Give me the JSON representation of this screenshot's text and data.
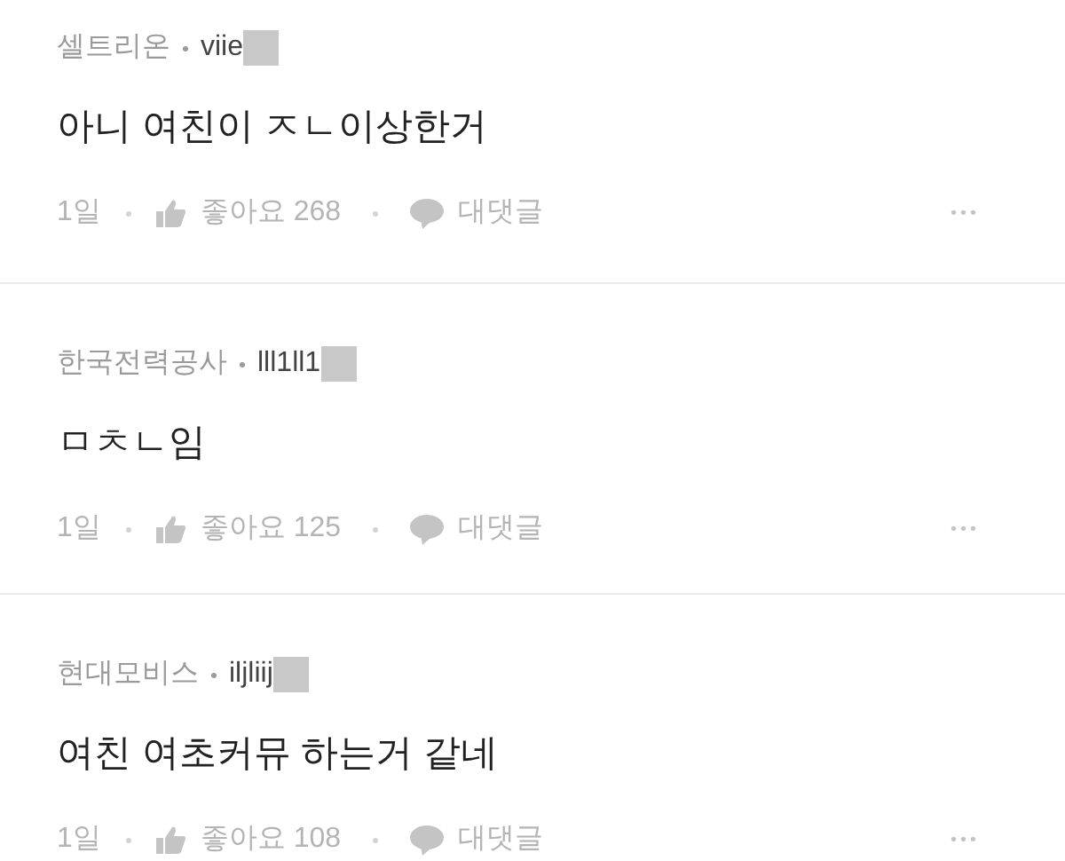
{
  "comments": [
    {
      "company": "셀트리온",
      "username": "viie",
      "text": "아니 여친이 ㅈㄴ이상한거",
      "time": "1일",
      "like_label": "좋아요",
      "likes": "268",
      "reply_label": "대댓글",
      "more": "•••"
    },
    {
      "company": "한국전력공사",
      "username": "lll1ll1",
      "text": "ㅁㅊㄴ임",
      "time": "1일",
      "like_label": "좋아요",
      "likes": "125",
      "reply_label": "대댓글",
      "more": "•••"
    },
    {
      "company": "현대모비스",
      "username": "iljliij",
      "text": "여친 여초커뮤 하는거 같네",
      "time": "1일",
      "like_label": "좋아요",
      "likes": "108",
      "reply_label": "대댓글",
      "more": "•••"
    }
  ]
}
